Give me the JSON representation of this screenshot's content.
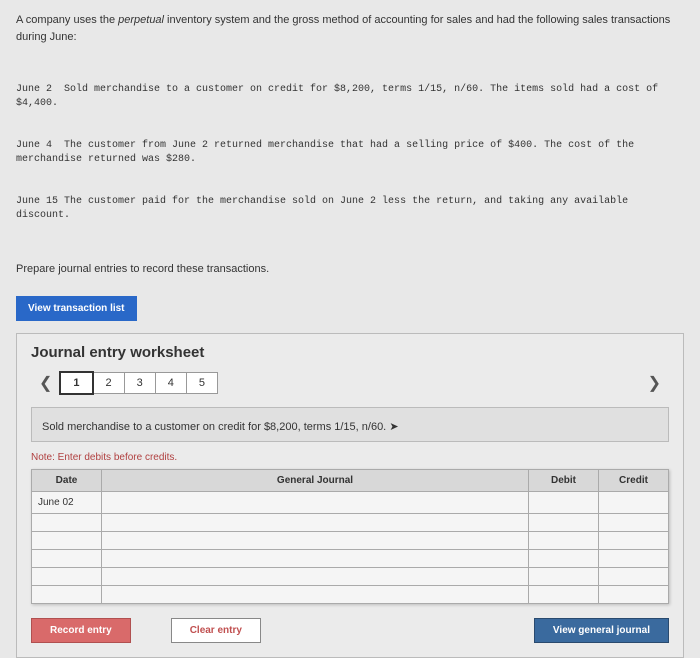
{
  "problem": {
    "intro_a": "A company uses the ",
    "intro_emph": "perpetual",
    "intro_b": " inventory system and the gross method of accounting for sales and had the following sales transactions during June:",
    "txn_line1": "June 2  Sold merchandise to a customer on credit for $8,200, terms 1/15, n/60. The items sold had a cost of $4,400.",
    "txn_line2": "June 4  The customer from June 2 returned merchandise that had a selling price of $400. The cost of the merchandise returned was $280.",
    "txn_line3": "June 15 The customer paid for the merchandise sold on June 2 less the return, and taking any available discount.",
    "instruction": "Prepare journal entries to record these transactions."
  },
  "buttons": {
    "view_transaction": "View transaction list",
    "record": "Record entry",
    "clear": "Clear entry",
    "view_journal": "View general journal"
  },
  "worksheet": {
    "title": "Journal entry worksheet",
    "tabs": [
      "1",
      "2",
      "3",
      "4",
      "5"
    ],
    "entry_desc": "Sold merchandise to a customer on credit for $8,200, terms 1/15, n/60.",
    "note": "Note: Enter debits before credits.",
    "headers": {
      "date": "Date",
      "gj": "General Journal",
      "debit": "Debit",
      "credit": "Credit"
    },
    "date_value": "June 02"
  }
}
